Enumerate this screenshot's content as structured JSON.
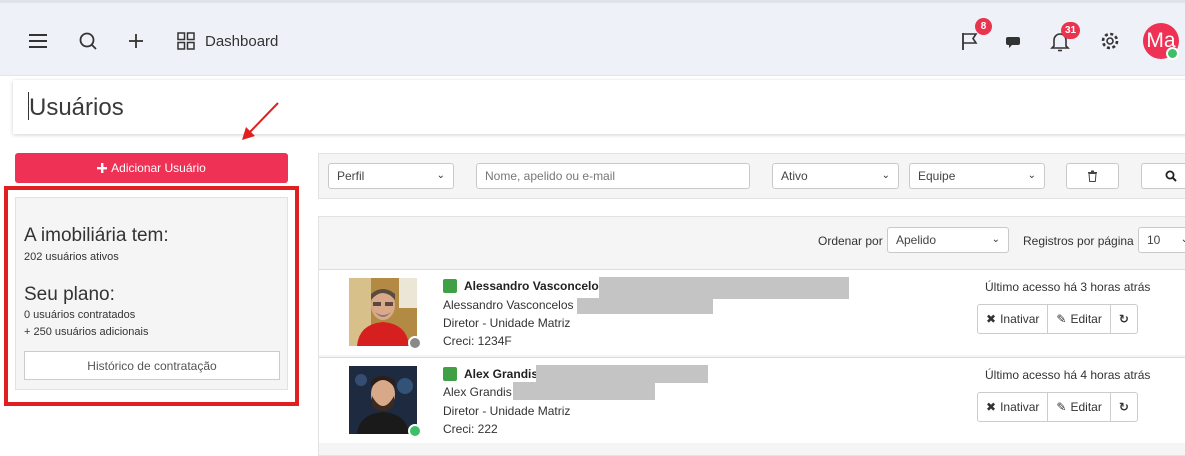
{
  "topbar": {
    "dashboard_label": "Dashboard",
    "flag_badge": "8",
    "bell_badge": "31",
    "avatar_initials": "Ma"
  },
  "page": {
    "title": "Usuários"
  },
  "sidebar": {
    "add_user_label": "Adicionar Usuário",
    "heading_company": "A imobiliária tem:",
    "active_users": "202 usuários ativos",
    "heading_plan": "Seu plano:",
    "contracted_users": "0 usuários contratados",
    "additional_users": "+ 250 usuários adicionais",
    "history_button": "Histórico de contratação"
  },
  "filters": {
    "profile": "Perfil",
    "search_placeholder": "Nome, apelido ou e-mail",
    "status": "Ativo",
    "team": "Equipe"
  },
  "list": {
    "order_label": "Ordenar por",
    "order_value": "Apelido",
    "per_page_label": "Registros por página",
    "per_page_value": "10",
    "users": [
      {
        "name": "Alessandro Vasconcelos",
        "full_name": "Alessandro Vasconcelos -",
        "role": "Diretor  - Unidade Matriz",
        "creci": "Creci: 1234F",
        "last_access": "Último acesso há 3 horas atrás",
        "status_color": "#8a8a8a"
      },
      {
        "name": "Alex Grandis",
        "full_name": "Alex Grandis",
        "role": "Diretor  - Unidade Matriz",
        "creci": "Creci: 222",
        "last_access": "Último acesso há 4 horas atrás",
        "status_color": "#3dbf68"
      }
    ],
    "actions": {
      "deactivate": "Inativar",
      "edit": "Editar"
    }
  },
  "colors": {
    "accent": "#ee3154",
    "annotation_red": "#e02020",
    "online_green": "#3dbf68"
  },
  "icons": [
    "hamburger-icon",
    "search-icon",
    "plus-icon",
    "grid-icon",
    "flag-icon",
    "chat-icon",
    "bell-icon",
    "gear-icon",
    "trash-icon",
    "refresh-icon",
    "pencil-icon",
    "x-icon"
  ]
}
